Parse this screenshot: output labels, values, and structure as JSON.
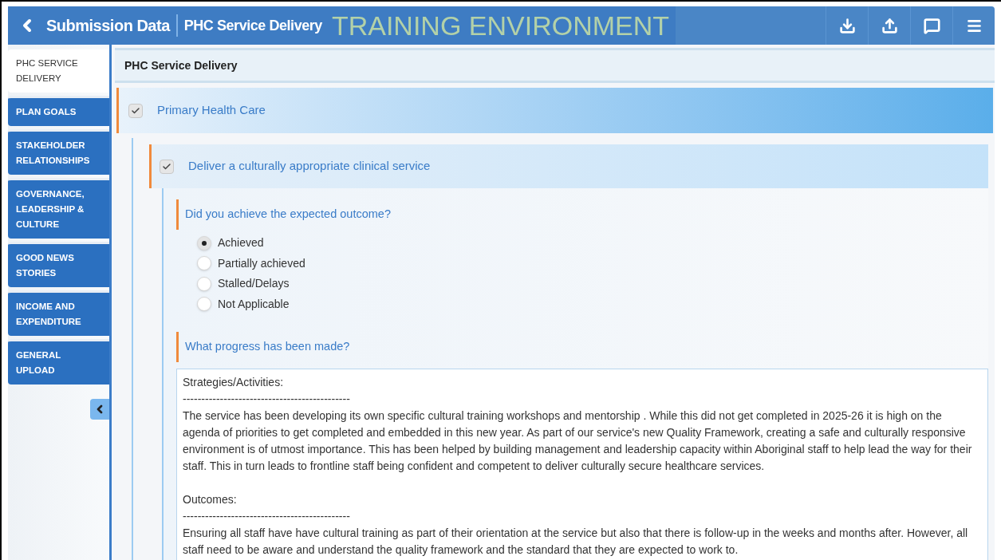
{
  "header": {
    "title": "Submission Data",
    "subtitle": "PHC Service Delivery",
    "environment": "TRAINING ENVIRONMENT"
  },
  "sidebar": {
    "items": [
      {
        "label": "PHC SERVICE DELIVERY",
        "selected": true
      },
      {
        "label": "PLAN GOALS",
        "selected": false
      },
      {
        "label": "STAKEHOLDER RELATIONSHIPS",
        "selected": false
      },
      {
        "label": "GOVERNANCE, LEADERSHIP & CULTURE",
        "selected": false
      },
      {
        "label": "GOOD NEWS STORIES",
        "selected": false
      },
      {
        "label": "INCOME AND EXPENDITURE",
        "selected": false
      },
      {
        "label": "GENERAL UPLOAD",
        "selected": false
      }
    ]
  },
  "section_title": "PHC Service Delivery",
  "outcome": {
    "label": "Primary Health Care",
    "checked": true,
    "children": [
      {
        "label": "Deliver a culturally appropriate clinical service",
        "checked": true,
        "questions": [
          {
            "kind": "radio",
            "label": "Did you achieve the expected outcome?",
            "options": [
              {
                "label": "Achieved",
                "selected": true
              },
              {
                "label": "Partially achieved",
                "selected": false
              },
              {
                "label": "Stalled/Delays",
                "selected": false
              },
              {
                "label": "Not Applicable",
                "selected": false
              }
            ]
          },
          {
            "kind": "text",
            "label": "What progress has been made?",
            "value": [
              [
                "Strategies/Activities:",
                "---------------------------------------------",
                "The service has been developing its own specific cultural training workshops and mentorship . While this did not get completed in 2025-26 it is high on the agenda of priorities to get completed and embedded in this new year. As part of our service's new Quality Framework, creating a safe and culturally responsive environment is of utmost importance. This has been helped by building management and leadership capacity within Aboriginal staff to help lead the way for their staff. This in turn leads to frontline staff being confident and competent to deliver culturally secure healthcare services."
              ],
              [
                "Outcomes:",
                "---------------------------------------------",
                "Ensuring all staff have have cultural training as part of their orientation at the service but also that there is follow-up in the weeks and months after. However, all staff need to be aware and understand the quality framework and the standard that they are expected to work to."
              ]
            ]
          }
        ]
      }
    ]
  }
}
